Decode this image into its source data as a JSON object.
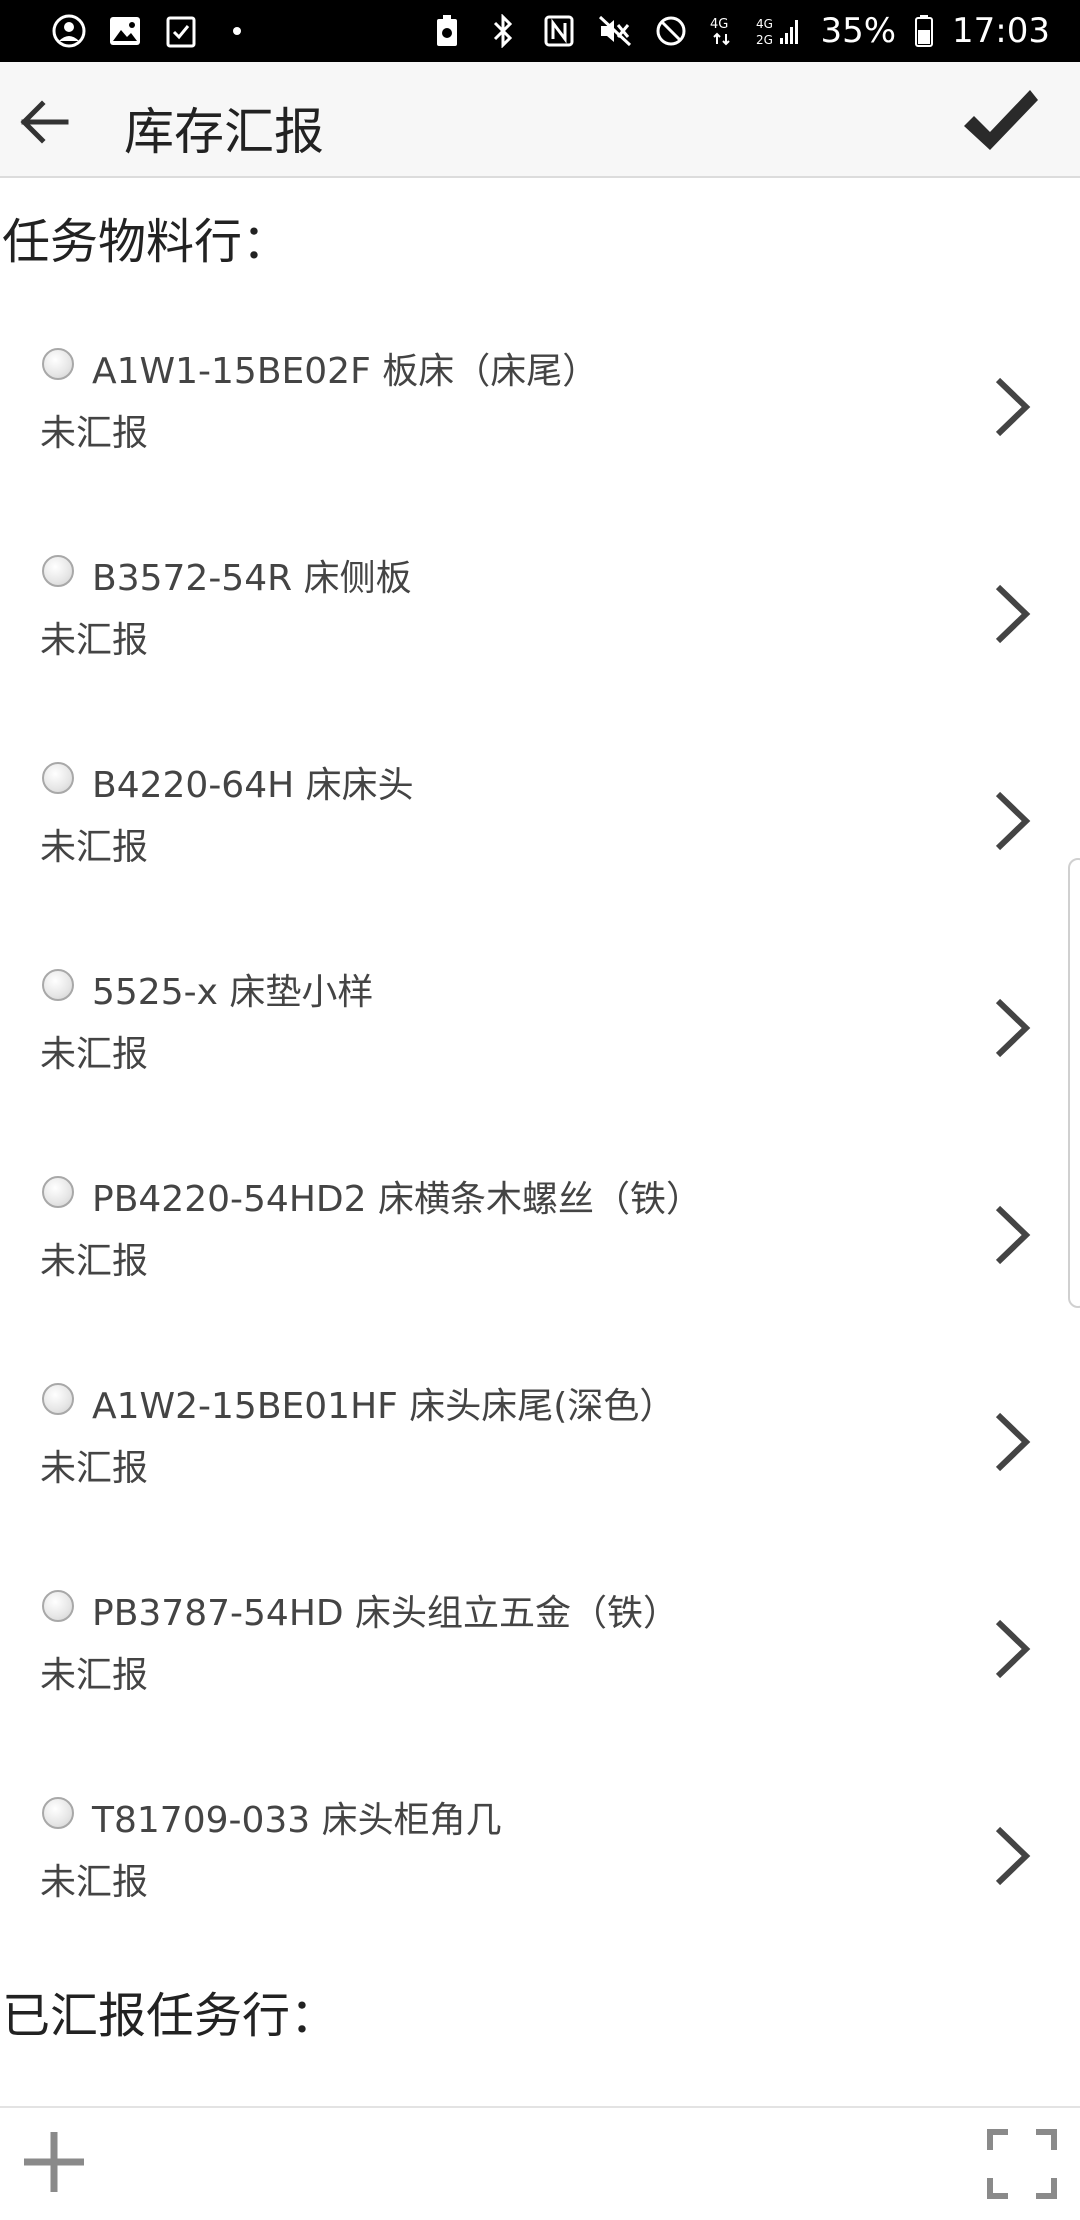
{
  "status_bar": {
    "battery": "35%",
    "time": "17:03",
    "net_top": "4G",
    "net_sim2_top": "4G",
    "net_sim2_bottom": "2G"
  },
  "app_bar": {
    "title": "库存汇报"
  },
  "sections": {
    "materials_header": "任务物料行：",
    "reported_header": "已汇报任务行："
  },
  "items": [
    {
      "title": "A1W1-15BE02F 板床（床尾）",
      "status": "未汇报"
    },
    {
      "title": "B3572-54R 床侧板",
      "status": "未汇报"
    },
    {
      "title": "B4220-64H 床床头",
      "status": "未汇报"
    },
    {
      "title": "5525-x 床垫小样",
      "status": "未汇报"
    },
    {
      "title": "PB4220-54HD2 床横条木螺丝（铁）",
      "status": "未汇报"
    },
    {
      "title": "A1W2-15BE01HF 床头床尾(深色）",
      "status": "未汇报"
    },
    {
      "title": "PB3787-54HD 床头组立五金（铁）",
      "status": "未汇报"
    },
    {
      "title": "T81709-033 床头柜角几",
      "status": "未汇报"
    }
  ],
  "colors": {
    "status_bar_bg": "#000000",
    "app_bar_bg": "#f7f7f7",
    "icon_dark": "#333333",
    "icon_gray": "#8a8a8a"
  }
}
